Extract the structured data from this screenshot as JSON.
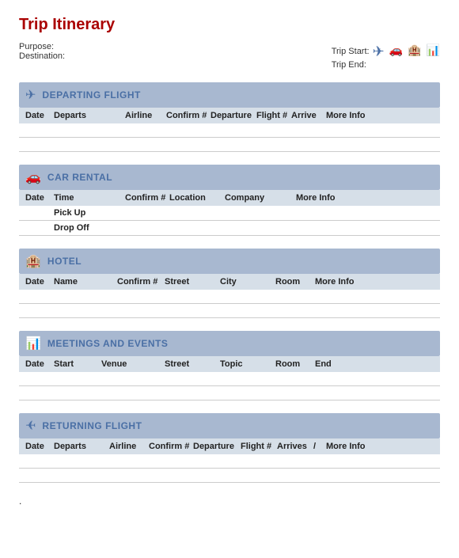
{
  "page": {
    "title": "Trip Itinerary",
    "meta": {
      "purpose_label": "Purpose:",
      "destination_label": "Destination:",
      "trip_start_label": "Trip Start:",
      "trip_end_label": "Trip End:"
    },
    "icons": {
      "plane": "✈",
      "car": "🚗",
      "hotel": "🏢",
      "chart": "📊"
    }
  },
  "sections": {
    "departing_flight": {
      "title": "DEPARTING FLIGHT",
      "columns": [
        "Date",
        "Departs",
        "Airline",
        "Confirm #",
        "Departure",
        "Flight #",
        "Arrive",
        "More Info"
      ]
    },
    "car_rental": {
      "title": "CAR RENTAL",
      "columns": [
        "Date",
        "Time",
        "Confirm #",
        "Location",
        "Company",
        "",
        "More Info"
      ],
      "sub_rows": [
        "Pick Up",
        "Drop Off"
      ]
    },
    "hotel": {
      "title": "HOTEL",
      "columns": [
        "Date",
        "Name",
        "Confirm #",
        "Street",
        "City",
        "Room",
        "More Info"
      ]
    },
    "meetings": {
      "title": "MEETINGS AND EVENTS",
      "columns": [
        "Date",
        "Start",
        "Venue",
        "Street",
        "Topic",
        "Room",
        "End"
      ]
    },
    "returning_flight": {
      "title": "RETURNING FLIGHT",
      "columns": [
        "Date",
        "Departs",
        "Airline",
        "Confirm #",
        "Departure",
        "Flight #",
        "Arrives",
        "/",
        "More Info"
      ]
    }
  },
  "footer": {
    "dot": "."
  }
}
